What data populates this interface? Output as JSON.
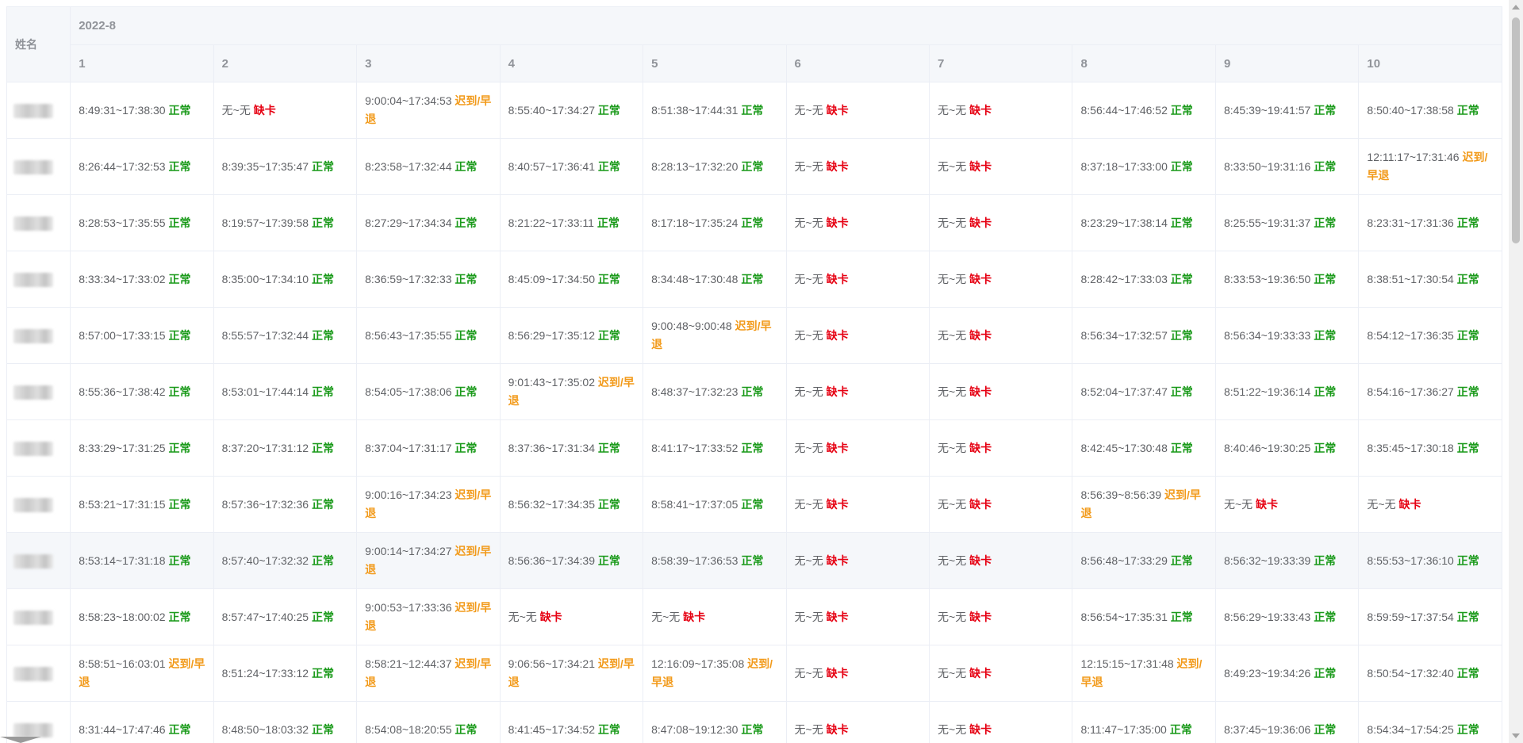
{
  "table": {
    "name_header": "姓名",
    "month_header": "2022-8",
    "days": [
      "1",
      "2",
      "3",
      "4",
      "5",
      "6",
      "7",
      "8",
      "9",
      "10"
    ],
    "rows": [
      {
        "cells": [
          [
            "8:49:31~17:38:30",
            "正常"
          ],
          [
            "无~无",
            "缺卡"
          ],
          [
            "9:00:04~17:34:53",
            "迟到/早退"
          ],
          [
            "8:55:40~17:34:27",
            "正常"
          ],
          [
            "8:51:38~17:44:31",
            "正常"
          ],
          [
            "无~无",
            "缺卡"
          ],
          [
            "无~无",
            "缺卡"
          ],
          [
            "8:56:44~17:46:52",
            "正常"
          ],
          [
            "8:45:39~19:41:57",
            "正常"
          ],
          [
            "8:50:40~17:38:58",
            "正常"
          ]
        ]
      },
      {
        "cells": [
          [
            "8:26:44~17:32:53",
            "正常"
          ],
          [
            "8:39:35~17:35:47",
            "正常"
          ],
          [
            "8:23:58~17:32:44",
            "正常"
          ],
          [
            "8:40:57~17:36:41",
            "正常"
          ],
          [
            "8:28:13~17:32:20",
            "正常"
          ],
          [
            "无~无",
            "缺卡"
          ],
          [
            "无~无",
            "缺卡"
          ],
          [
            "8:37:18~17:33:00",
            "正常"
          ],
          [
            "8:33:50~19:31:16",
            "正常"
          ],
          [
            "12:11:17~17:31:46",
            "迟到/早退"
          ]
        ]
      },
      {
        "cells": [
          [
            "8:28:53~17:35:55",
            "正常"
          ],
          [
            "8:19:57~17:39:58",
            "正常"
          ],
          [
            "8:27:29~17:34:34",
            "正常"
          ],
          [
            "8:21:22~17:33:11",
            "正常"
          ],
          [
            "8:17:18~17:35:24",
            "正常"
          ],
          [
            "无~无",
            "缺卡"
          ],
          [
            "无~无",
            "缺卡"
          ],
          [
            "8:23:29~17:38:14",
            "正常"
          ],
          [
            "8:25:55~19:31:37",
            "正常"
          ],
          [
            "8:23:31~17:31:36",
            "正常"
          ]
        ]
      },
      {
        "cells": [
          [
            "8:33:34~17:33:02",
            "正常"
          ],
          [
            "8:35:00~17:34:10",
            "正常"
          ],
          [
            "8:36:59~17:32:33",
            "正常"
          ],
          [
            "8:45:09~17:34:50",
            "正常"
          ],
          [
            "8:34:48~17:30:48",
            "正常"
          ],
          [
            "无~无",
            "缺卡"
          ],
          [
            "无~无",
            "缺卡"
          ],
          [
            "8:28:42~17:33:03",
            "正常"
          ],
          [
            "8:33:53~19:36:50",
            "正常"
          ],
          [
            "8:38:51~17:30:54",
            "正常"
          ]
        ]
      },
      {
        "cells": [
          [
            "8:57:00~17:33:15",
            "正常"
          ],
          [
            "8:55:57~17:32:44",
            "正常"
          ],
          [
            "8:56:43~17:35:55",
            "正常"
          ],
          [
            "8:56:29~17:35:12",
            "正常"
          ],
          [
            "9:00:48~9:00:48",
            "迟到/早退"
          ],
          [
            "无~无",
            "缺卡"
          ],
          [
            "无~无",
            "缺卡"
          ],
          [
            "8:56:34~17:32:57",
            "正常"
          ],
          [
            "8:56:34~19:33:33",
            "正常"
          ],
          [
            "8:54:12~17:36:35",
            "正常"
          ]
        ]
      },
      {
        "cells": [
          [
            "8:55:36~17:38:42",
            "正常"
          ],
          [
            "8:53:01~17:44:14",
            "正常"
          ],
          [
            "8:54:05~17:38:06",
            "正常"
          ],
          [
            "9:01:43~17:35:02",
            "迟到/早退"
          ],
          [
            "8:48:37~17:32:23",
            "正常"
          ],
          [
            "无~无",
            "缺卡"
          ],
          [
            "无~无",
            "缺卡"
          ],
          [
            "8:52:04~17:37:47",
            "正常"
          ],
          [
            "8:51:22~19:36:14",
            "正常"
          ],
          [
            "8:54:16~17:36:27",
            "正常"
          ]
        ]
      },
      {
        "cells": [
          [
            "8:33:29~17:31:25",
            "正常"
          ],
          [
            "8:37:20~17:31:12",
            "正常"
          ],
          [
            "8:37:04~17:31:17",
            "正常"
          ],
          [
            "8:37:36~17:31:34",
            "正常"
          ],
          [
            "8:41:17~17:33:52",
            "正常"
          ],
          [
            "无~无",
            "缺卡"
          ],
          [
            "无~无",
            "缺卡"
          ],
          [
            "8:42:45~17:30:48",
            "正常"
          ],
          [
            "8:40:46~19:30:25",
            "正常"
          ],
          [
            "8:35:45~17:30:18",
            "正常"
          ]
        ]
      },
      {
        "cells": [
          [
            "8:53:21~17:31:15",
            "正常"
          ],
          [
            "8:57:36~17:32:36",
            "正常"
          ],
          [
            "9:00:16~17:34:23",
            "迟到/早退"
          ],
          [
            "8:56:32~17:34:35",
            "正常"
          ],
          [
            "8:58:41~17:37:05",
            "正常"
          ],
          [
            "无~无",
            "缺卡"
          ],
          [
            "无~无",
            "缺卡"
          ],
          [
            "8:56:39~8:56:39",
            "迟到/早退"
          ],
          [
            "无~无",
            "缺卡"
          ],
          [
            "无~无",
            "缺卡"
          ]
        ]
      },
      {
        "cells": [
          [
            "8:53:14~17:31:18",
            "正常"
          ],
          [
            "8:57:40~17:32:32",
            "正常"
          ],
          [
            "9:00:14~17:34:27",
            "迟到/早退"
          ],
          [
            "8:56:36~17:34:39",
            "正常"
          ],
          [
            "8:58:39~17:36:53",
            "正常"
          ],
          [
            "无~无",
            "缺卡"
          ],
          [
            "无~无",
            "缺卡"
          ],
          [
            "8:56:48~17:33:29",
            "正常"
          ],
          [
            "8:56:32~19:33:39",
            "正常"
          ],
          [
            "8:55:53~17:36:10",
            "正常"
          ]
        ]
      },
      {
        "cells": [
          [
            "8:58:23~18:00:02",
            "正常"
          ],
          [
            "8:57:47~17:40:25",
            "正常"
          ],
          [
            "9:00:53~17:33:36",
            "迟到/早退"
          ],
          [
            "无~无",
            "缺卡"
          ],
          [
            "无~无",
            "缺卡"
          ],
          [
            "无~无",
            "缺卡"
          ],
          [
            "无~无",
            "缺卡"
          ],
          [
            "8:56:54~17:35:31",
            "正常"
          ],
          [
            "8:56:29~19:33:43",
            "正常"
          ],
          [
            "8:59:59~17:37:54",
            "正常"
          ]
        ]
      },
      {
        "cells": [
          [
            "8:58:51~16:03:01",
            "迟到/早退"
          ],
          [
            "8:51:24~17:33:12",
            "正常"
          ],
          [
            "8:58:21~12:44:37",
            "迟到/早退"
          ],
          [
            "9:06:56~17:34:21",
            "迟到/早退"
          ],
          [
            "12:16:09~17:35:08",
            "迟到/早退"
          ],
          [
            "无~无",
            "缺卡"
          ],
          [
            "无~无",
            "缺卡"
          ],
          [
            "12:15:15~17:31:48",
            "迟到/早退"
          ],
          [
            "8:49:23~19:34:26",
            "正常"
          ],
          [
            "8:50:54~17:32:40",
            "正常"
          ]
        ]
      },
      {
        "cells": [
          [
            "8:31:44~17:47:46",
            "正常"
          ],
          [
            "8:48:50~18:03:32",
            "正常"
          ],
          [
            "8:54:08~18:20:55",
            "正常"
          ],
          [
            "8:41:45~17:34:52",
            "正常"
          ],
          [
            "8:47:08~19:12:30",
            "正常"
          ],
          [
            "无~无",
            "缺卡"
          ],
          [
            "无~无",
            "缺卡"
          ],
          [
            "8:11:47~17:35:00",
            "正常"
          ],
          [
            "8:37:45~19:36:06",
            "正常"
          ],
          [
            "8:54:34~17:54:25",
            "正常"
          ]
        ]
      }
    ]
  },
  "status_colors": {
    "正常": "#1a9a1a",
    "缺卡": "#e60012",
    "迟到/早退": "#f29a1a"
  }
}
